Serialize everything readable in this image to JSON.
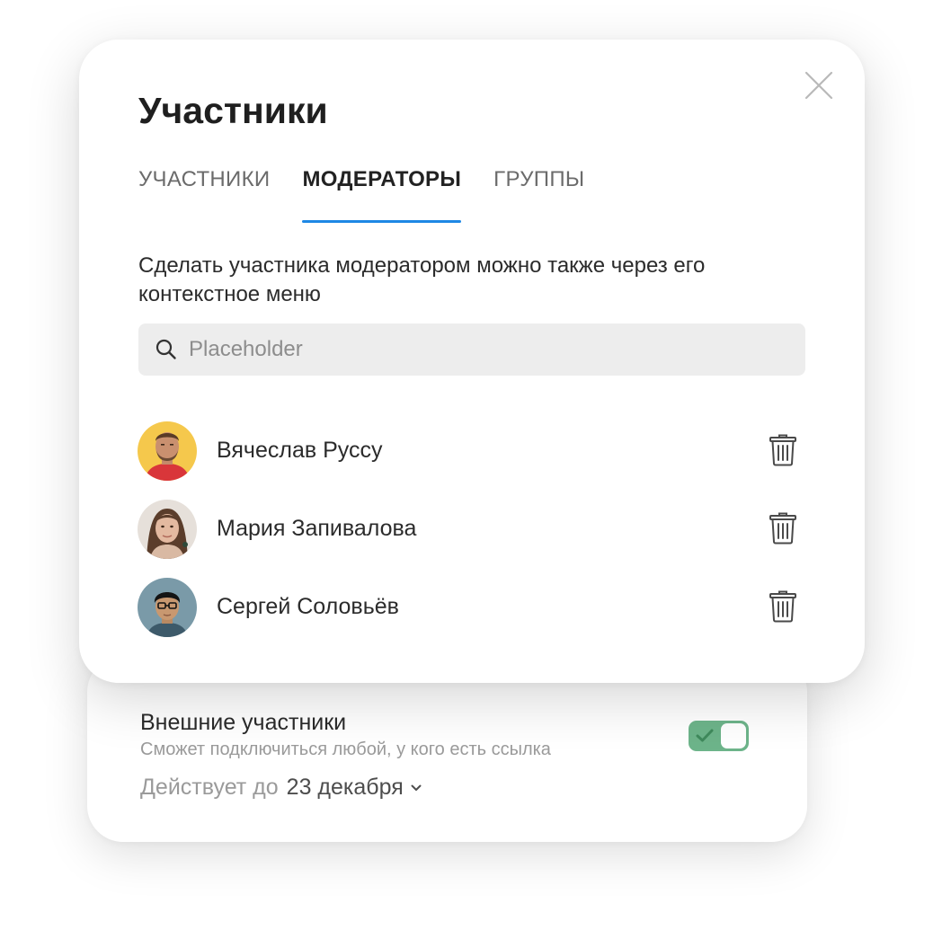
{
  "modal": {
    "title": "Участники",
    "close_icon": "close-icon",
    "tabs": [
      {
        "label": "УЧАСТНИКИ",
        "active": false
      },
      {
        "label": "МОДЕРАТОРЫ",
        "active": true
      },
      {
        "label": "ГРУППЫ",
        "active": false
      }
    ],
    "hint": "Сделать участника модератором можно также через его контекстное меню",
    "search": {
      "placeholder": "Placeholder",
      "value": "",
      "icon": "search-icon"
    },
    "moderators": [
      {
        "name": "Вячеслав Руссу",
        "avatar_bg": "#f5c84c",
        "remove_icon": "trash-icon"
      },
      {
        "name": "Мария Запивалова",
        "avatar_bg": "#d9cfc7",
        "remove_icon": "trash-icon"
      },
      {
        "name": "Сергей Соловьёв",
        "avatar_bg": "#7a9aa8",
        "remove_icon": "trash-icon"
      }
    ]
  },
  "external": {
    "title": "Внешние участники",
    "subtitle": "Сможет подключиться любой, у кого есть ссылка",
    "valid_label": "Действует до",
    "valid_date": "23 декабря",
    "toggle_on": true
  },
  "colors": {
    "accent": "#1e88e5",
    "toggle": "#6db48a"
  }
}
